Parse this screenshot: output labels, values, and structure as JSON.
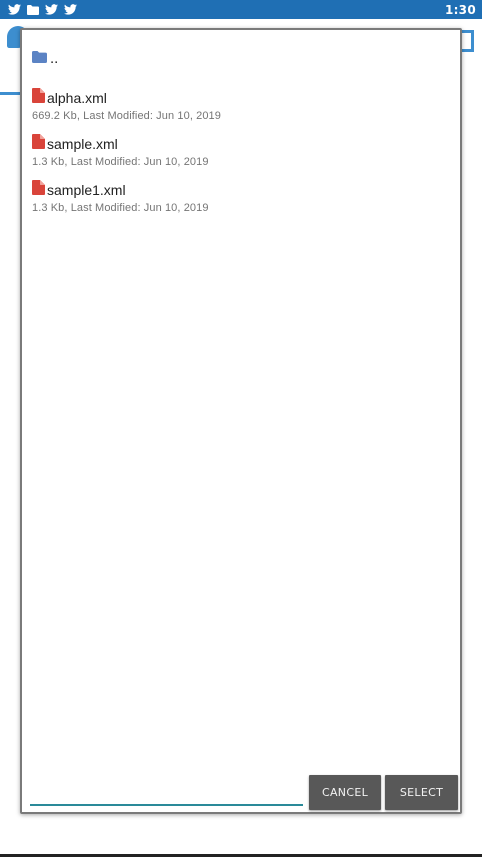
{
  "status_bar": {
    "time": "1:30",
    "icons": [
      "twitter-icon",
      "folder-icon",
      "twitter-icon",
      "twitter-icon"
    ],
    "color": "#1f6fb4"
  },
  "dialog": {
    "parent_entry": {
      "label": "..",
      "icon": "folder-icon",
      "icon_color": "#5b83c4"
    },
    "files": [
      {
        "name": "alpha.xml",
        "meta": "669.2 Kb, Last Modified: Jun 10, 2019",
        "icon": "file-icon",
        "icon_color": "#d9443a"
      },
      {
        "name": "sample.xml",
        "meta": "1.3 Kb, Last Modified: Jun 10, 2019",
        "icon": "file-icon",
        "icon_color": "#d9443a"
      },
      {
        "name": "sample1.xml",
        "meta": "1.3 Kb, Last Modified: Jun 10, 2019",
        "icon": "file-icon",
        "icon_color": "#d9443a"
      }
    ],
    "filename_input": {
      "value": "",
      "placeholder": ""
    },
    "buttons": {
      "cancel_label": "CANCEL",
      "select_label": "SELECT"
    },
    "accent_color": "#2a8a99"
  }
}
